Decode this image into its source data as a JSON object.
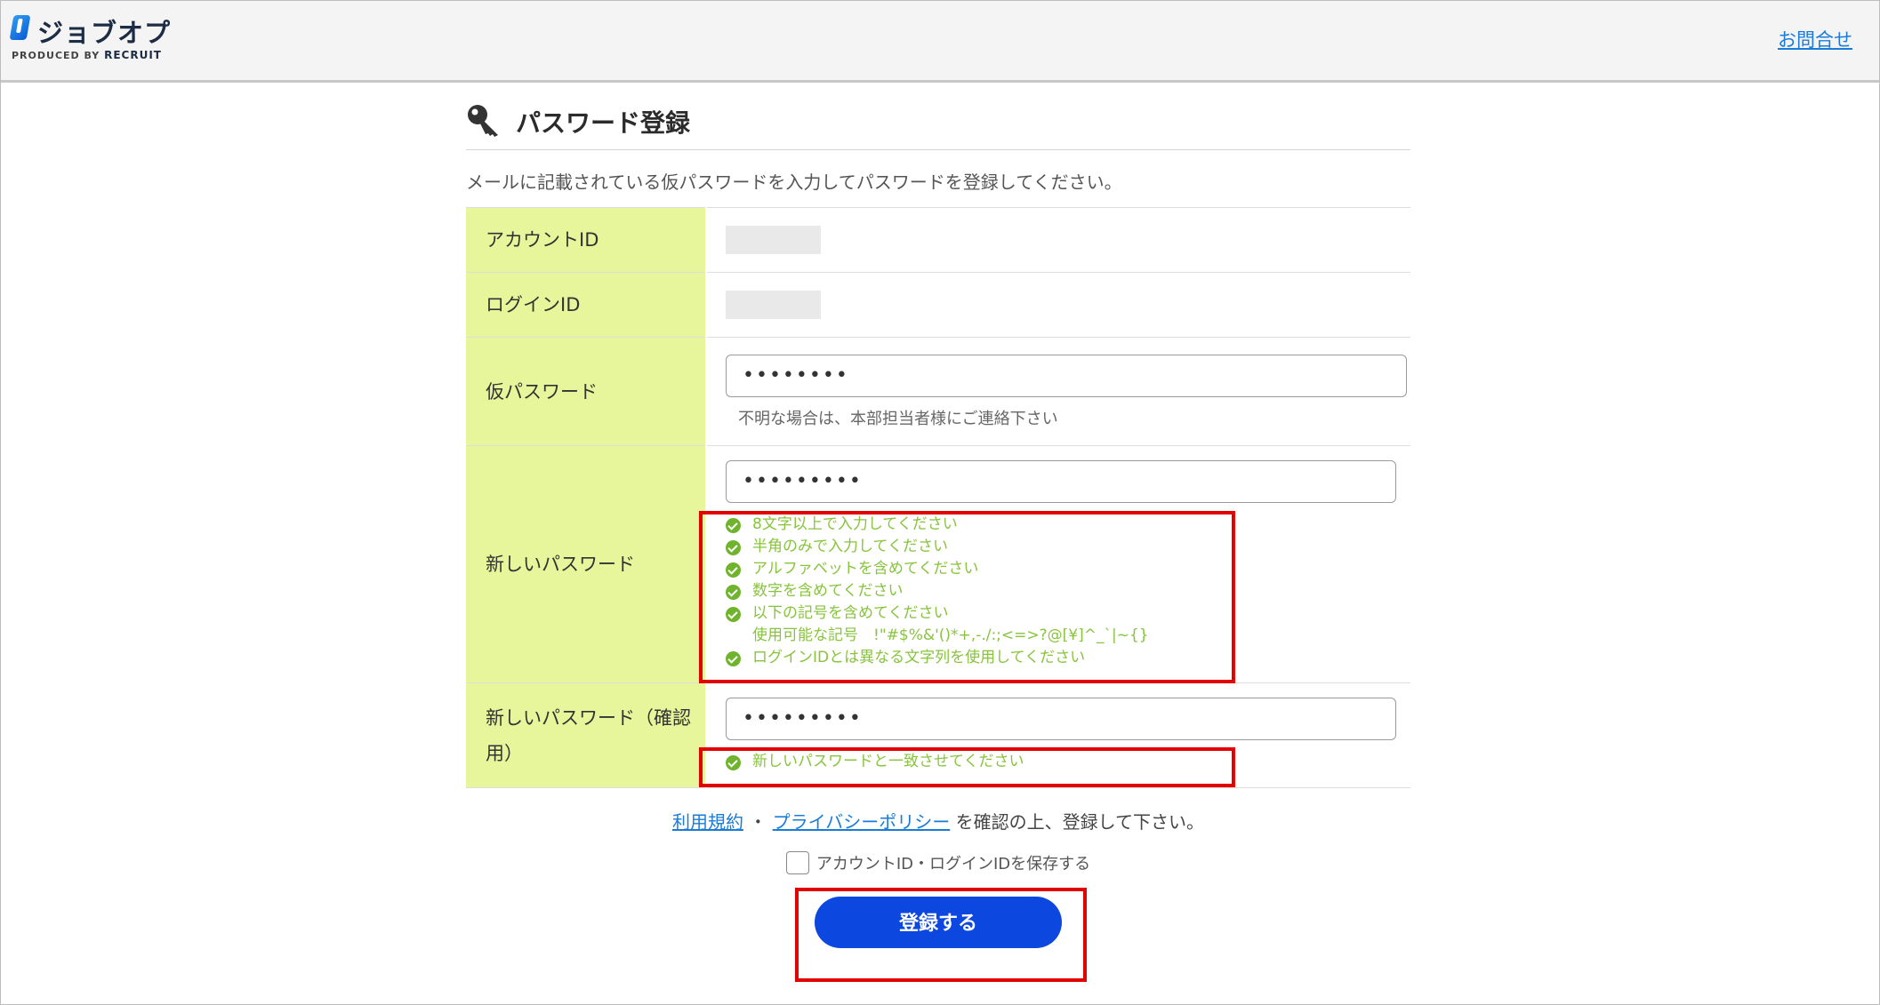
{
  "header": {
    "logo_text": "ジョブオプ",
    "logo_sub": "PRODUCED BY",
    "logo_brand": "RECRUIT",
    "contact_link": "お問合せ"
  },
  "page": {
    "title": "パスワード登録",
    "intro": "メールに記載されている仮パスワードを入力してパスワードを登録してください。"
  },
  "form": {
    "account_id_label": "アカウントID",
    "login_id_label": "ログインID",
    "temp_password_label": "仮パスワード",
    "temp_password_value": "••••••••",
    "temp_password_hint": "不明な場合は、本部担当者様にご連絡下さい",
    "new_password_label": "新しいパスワード",
    "new_password_value": "•••••••••",
    "new_password_rules": [
      "8文字以上で入力してください",
      "半角のみで入力してください",
      "アルファベットを含めてください",
      "数字を含めてください",
      "以下の記号を含めてください",
      "ログインIDとは異なる文字列を使用してください"
    ],
    "symbols_note": "使用可能な記号　!\"#$%&'()*+,-./:;<=>?@[¥]^_`|~{}",
    "confirm_password_label": "新しいパスワード（確認用）",
    "confirm_password_value": "•••••••••",
    "confirm_rule": "新しいパスワードと一致させてください"
  },
  "consent": {
    "terms_link": "利用規約",
    "separator": "・",
    "privacy_link": "プライバシーポリシー",
    "suffix": "を確認の上、登録して下さい。"
  },
  "save_ids_label": "アカウントID・ログインIDを保存する",
  "submit_label": "登録する",
  "colors": {
    "label_bg": "#e7f69b",
    "rule_green": "#87c43c",
    "submit_blue": "#0c47e0",
    "highlight_red": "#e30000",
    "link_blue": "#1a7cd8"
  }
}
